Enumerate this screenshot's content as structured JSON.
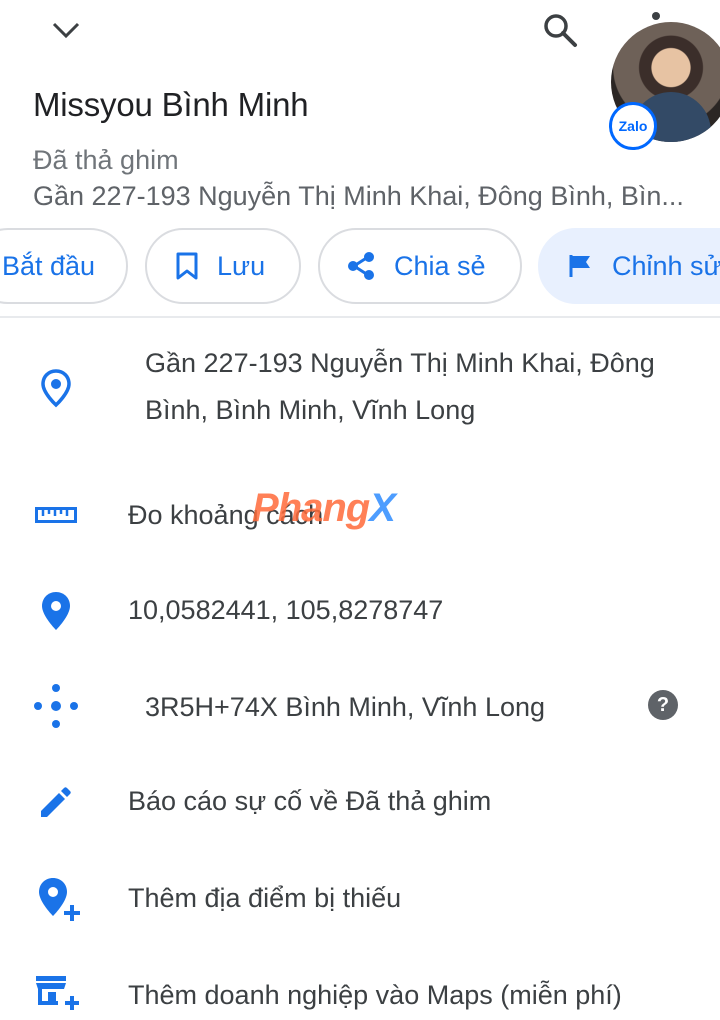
{
  "header": {
    "title": "Missyou Bình Minh",
    "subtitle": "Đã thả ghim",
    "address_short": "Gần 227-193 Nguyễn Thị Minh Khai, Đông Bình, Bìn..."
  },
  "avatar": {
    "badge": "Zalo"
  },
  "chips": [
    {
      "label": "Bắt đầu",
      "icon": "navigation-icon"
    },
    {
      "label": "Lưu",
      "icon": "bookmark-icon"
    },
    {
      "label": "Chia sẻ",
      "icon": "share-icon"
    },
    {
      "label": "Chỉnh sửa",
      "icon": "flag-icon"
    }
  ],
  "details": {
    "address": "Gần 227-193 Nguyễn Thị Minh Khai, Đông Bình, Bình Minh, Vĩnh Long",
    "measure": "Đo khoảng cách",
    "coordinates": "10,0582441, 105,8278747",
    "plus_code": "3R5H+74X Bình Minh, Vĩnh Long",
    "report": "Báo cáo sự cố về Đã thả ghim",
    "add_place": "Thêm địa điểm bị thiếu",
    "add_business": "Thêm doanh nghiệp vào Maps (miễn phí)"
  },
  "watermark": {
    "part1": "Phang",
    "part2": "X"
  },
  "colors": {
    "accent": "#1a73e8",
    "text": "#3c4043",
    "muted": "#70757a",
    "chip_fill": "#e8f0fe"
  }
}
